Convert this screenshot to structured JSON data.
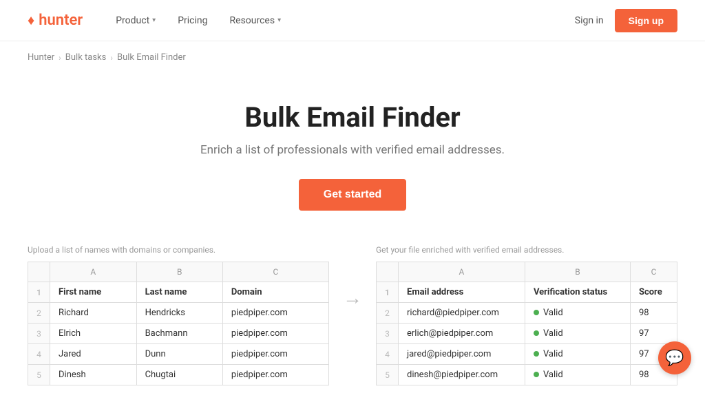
{
  "nav": {
    "logo_icon": "♦",
    "logo_text": "hunter",
    "links": [
      {
        "label": "Product",
        "has_chevron": true
      },
      {
        "label": "Pricing",
        "has_chevron": false
      },
      {
        "label": "Resources",
        "has_chevron": true
      }
    ],
    "sign_in": "Sign in",
    "sign_up": "Sign up"
  },
  "breadcrumb": {
    "items": [
      "Hunter",
      "Bulk tasks",
      "Bulk Email Finder"
    ]
  },
  "hero": {
    "title": "Bulk Email Finder",
    "subtitle": "Enrich a list of professionals with verified email addresses.",
    "cta": "Get started"
  },
  "left_table": {
    "label": "Upload a list of names with domains or companies.",
    "col_headers": [
      "",
      "A",
      "B",
      "C"
    ],
    "rows": [
      {
        "num": "1",
        "cells": [
          "First name",
          "Last name",
          "Domain"
        ]
      },
      {
        "num": "2",
        "cells": [
          "Richard",
          "Hendricks",
          "piedpiper.com"
        ]
      },
      {
        "num": "3",
        "cells": [
          "Elrich",
          "Bachmann",
          "piedpiper.com"
        ]
      },
      {
        "num": "4",
        "cells": [
          "Jared",
          "Dunn",
          "piedpiper.com"
        ]
      },
      {
        "num": "5",
        "cells": [
          "Dinesh",
          "Chugtai",
          "piedpiper.com"
        ]
      }
    ]
  },
  "right_table": {
    "label": "Get your file enriched with verified email addresses.",
    "col_headers": [
      "",
      "A",
      "B",
      "C"
    ],
    "rows": [
      {
        "num": "1",
        "cells": [
          "Email address",
          "Verification status",
          "Score"
        ],
        "header": true
      },
      {
        "num": "2",
        "cells": [
          "richard@piedpiper.com",
          "Valid",
          "98"
        ],
        "valid": true
      },
      {
        "num": "3",
        "cells": [
          "erlich@piedpiper.com",
          "Valid",
          "97"
        ],
        "valid": true
      },
      {
        "num": "4",
        "cells": [
          "jared@piedpiper.com",
          "Valid",
          "97"
        ],
        "valid": true
      },
      {
        "num": "5",
        "cells": [
          "dinesh@piedpiper.com",
          "Valid",
          "98"
        ],
        "valid": true
      }
    ]
  },
  "chat": {
    "icon": "💬"
  }
}
